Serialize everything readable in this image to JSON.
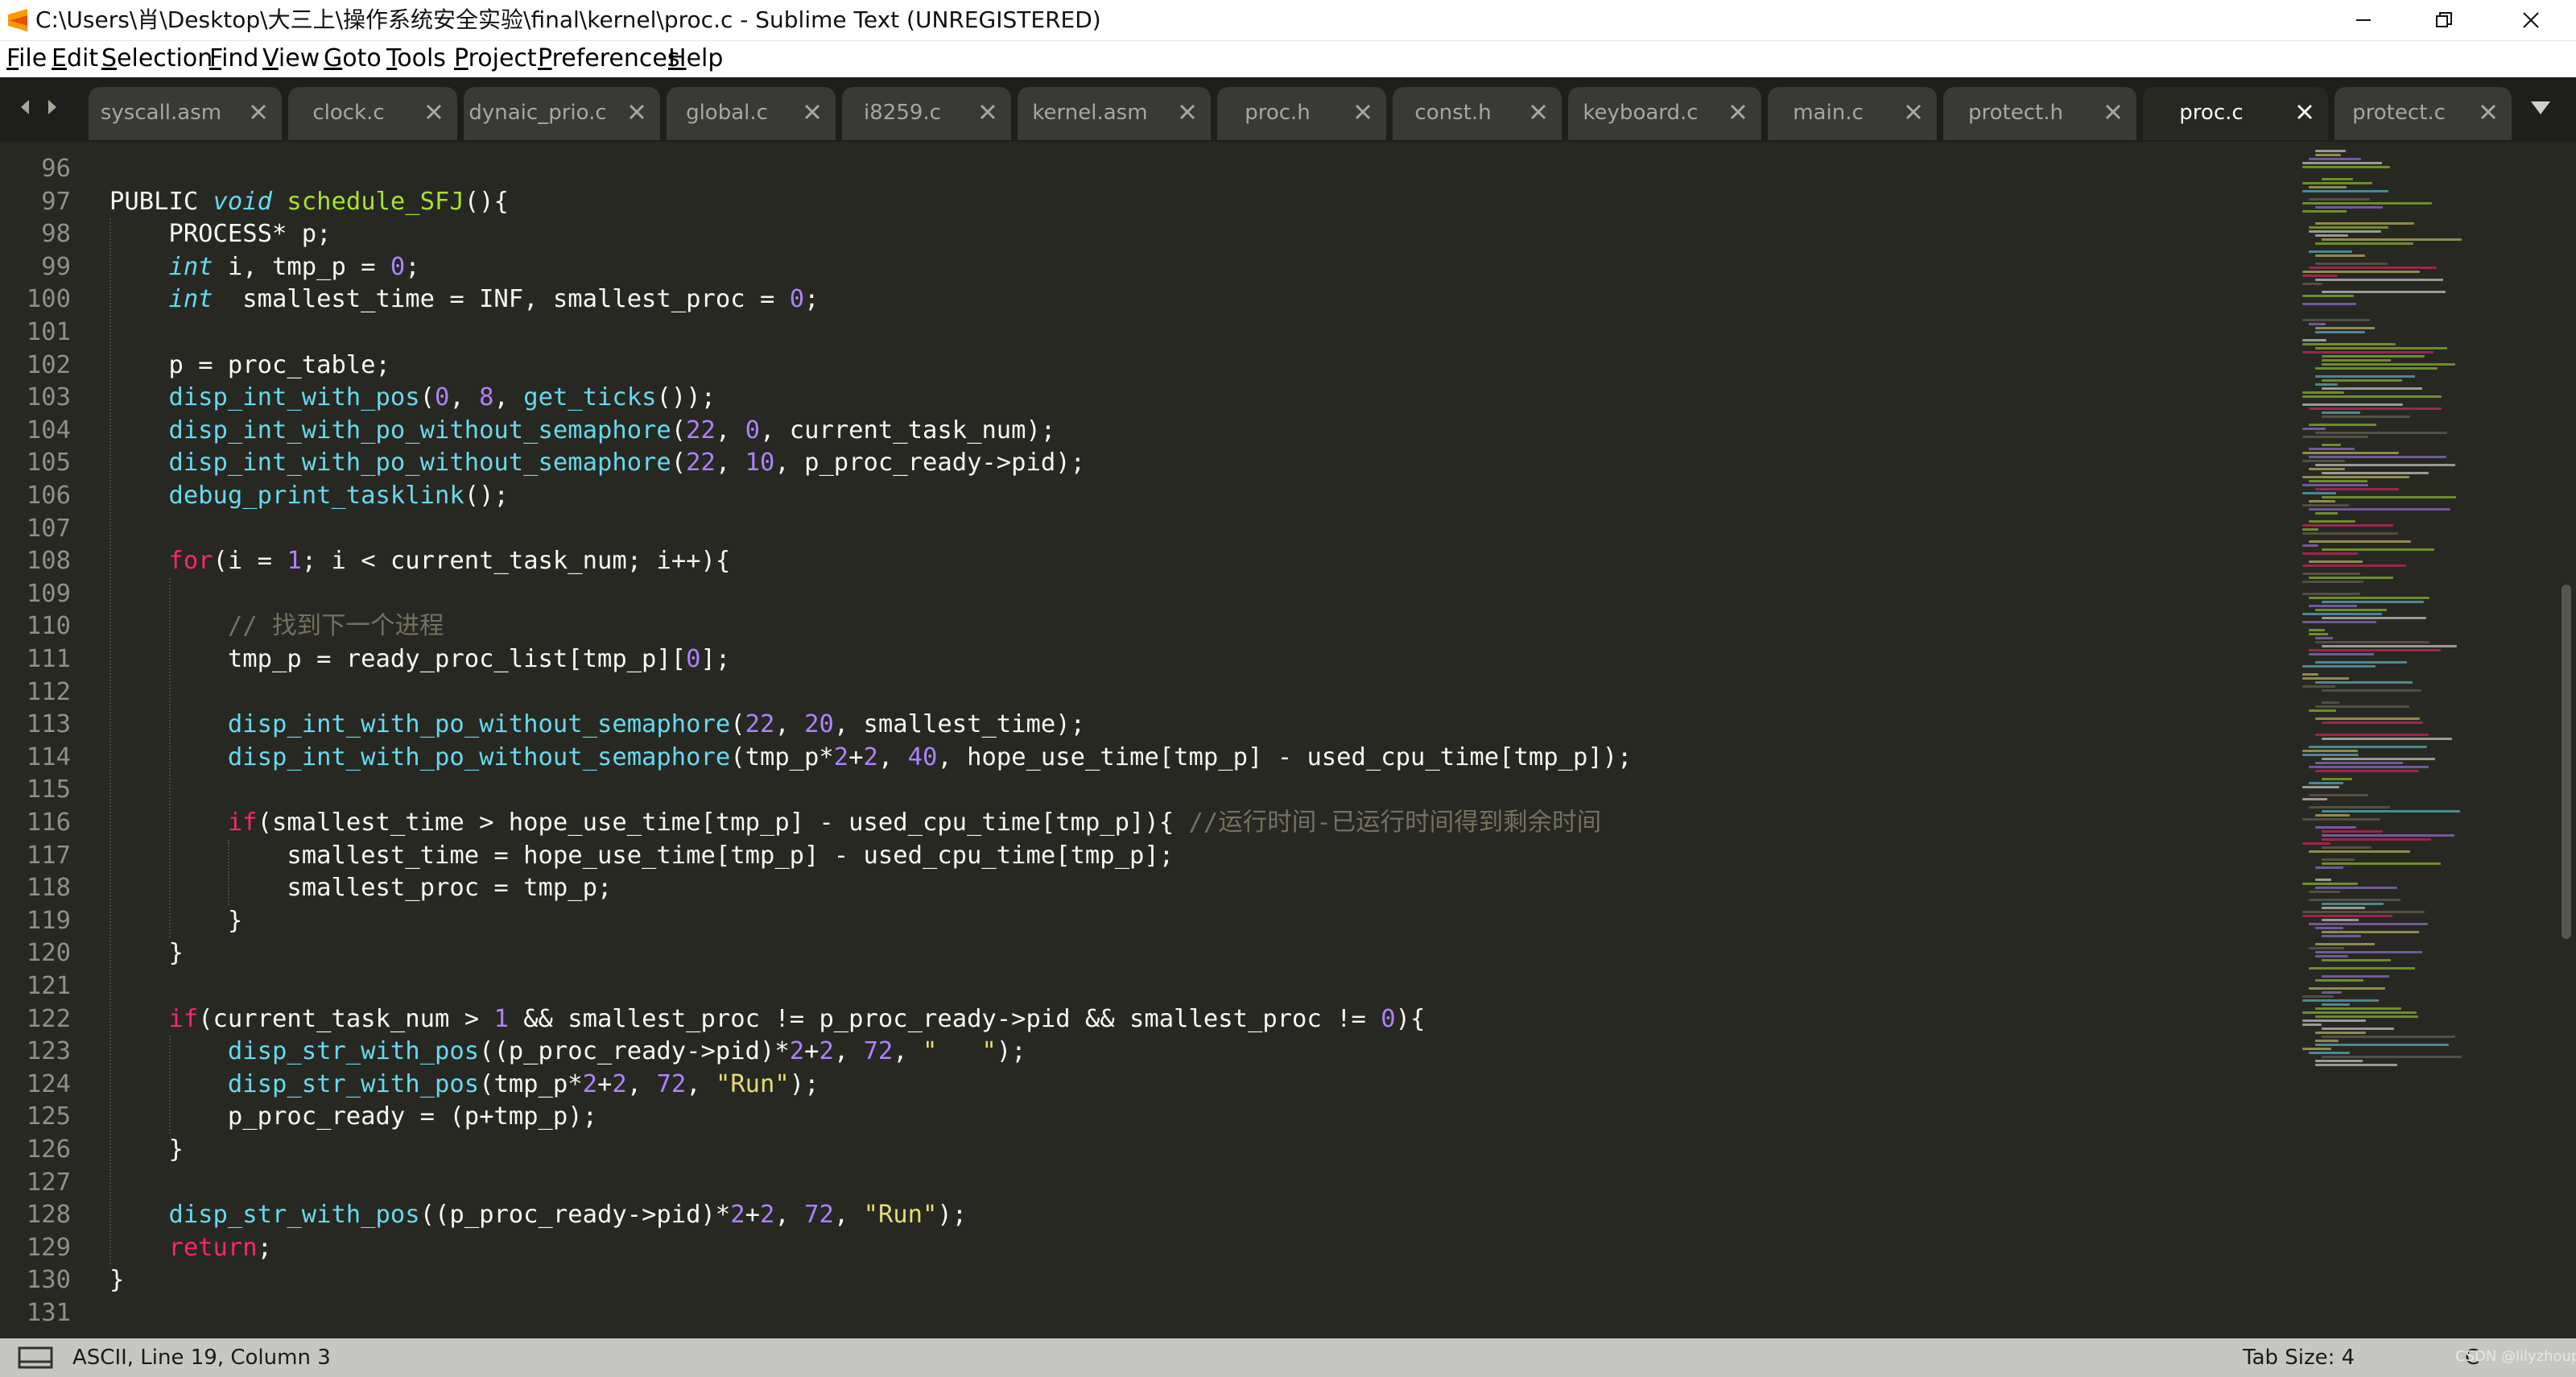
{
  "window": {
    "title": "C:\\Users\\肖\\Desktop\\大三上\\操作系统安全实验\\final\\kernel\\proc.c - Sublime Text (UNREGISTERED)",
    "icon": "sublime-text-icon"
  },
  "menu": {
    "items": [
      {
        "mn": "F",
        "rest": "ile"
      },
      {
        "mn": "E",
        "rest": "dit"
      },
      {
        "mn": "S",
        "rest": "election"
      },
      {
        "mn": "F",
        "rest": "ind"
      },
      {
        "mn": "V",
        "rest": "iew"
      },
      {
        "mn": "G",
        "rest": "oto"
      },
      {
        "mn": "T",
        "rest": "ools"
      },
      {
        "mn": "P",
        "rest": "roject"
      },
      {
        "mn": "P",
        "rest": "references"
      },
      {
        "mn": "H",
        "rest": "elp"
      }
    ]
  },
  "tabs": [
    {
      "label": "syscall.asm",
      "active": false
    },
    {
      "label": "clock.c",
      "active": false
    },
    {
      "label": "dynaic_prio.c",
      "active": false
    },
    {
      "label": "global.c",
      "active": false
    },
    {
      "label": "i8259.c",
      "active": false
    },
    {
      "label": "kernel.asm",
      "active": false
    },
    {
      "label": "proc.h",
      "active": false
    },
    {
      "label": "const.h",
      "active": false
    },
    {
      "label": "keyboard.c",
      "active": false
    },
    {
      "label": "main.c",
      "active": false
    },
    {
      "label": "protect.h",
      "active": false
    },
    {
      "label": "proc.c",
      "active": true
    },
    {
      "label": "protect.c",
      "active": false
    }
  ],
  "editor": {
    "line_numbers": [
      "96",
      "97",
      "98",
      "99",
      "100",
      "101",
      "102",
      "103",
      "104",
      "105",
      "106",
      "107",
      "108",
      "109",
      "110",
      "111",
      "112",
      "113",
      "114",
      "115",
      "116",
      "117",
      "118",
      "119",
      "120",
      "121",
      "122",
      "123",
      "124",
      "125",
      "126",
      "127",
      "128",
      "129",
      "130",
      "131"
    ],
    "lines": [
      [],
      [
        [
          "pl",
          "PUBLIC "
        ],
        [
          "ty",
          "void"
        ],
        [
          "pl",
          " "
        ],
        [
          "fn",
          "schedule_SFJ"
        ],
        [
          "pl",
          "(){"
        ]
      ],
      [
        [
          "pl",
          "    PROCESS* p;"
        ]
      ],
      [
        [
          "pl",
          "    "
        ],
        [
          "ty",
          "int"
        ],
        [
          "pl",
          " i, tmp_p = "
        ],
        [
          "nu",
          "0"
        ],
        [
          "pl",
          ";"
        ]
      ],
      [
        [
          "pl",
          "    "
        ],
        [
          "ty",
          "int"
        ],
        [
          "pl",
          "  smallest_time = INF, smallest_proc = "
        ],
        [
          "nu",
          "0"
        ],
        [
          "pl",
          ";"
        ]
      ],
      [],
      [
        [
          "pl",
          "    p = proc_table;"
        ]
      ],
      [
        [
          "pl",
          "    "
        ],
        [
          "ca",
          "disp_int_with_pos"
        ],
        [
          "pl",
          "("
        ],
        [
          "nu",
          "0"
        ],
        [
          "pl",
          ", "
        ],
        [
          "nu",
          "8"
        ],
        [
          "pl",
          ", "
        ],
        [
          "ca",
          "get_ticks"
        ],
        [
          "pl",
          "());"
        ]
      ],
      [
        [
          "pl",
          "    "
        ],
        [
          "ca",
          "disp_int_with_po_without_semaphore"
        ],
        [
          "pl",
          "("
        ],
        [
          "nu",
          "22"
        ],
        [
          "pl",
          ", "
        ],
        [
          "nu",
          "0"
        ],
        [
          "pl",
          ", current_task_num);"
        ]
      ],
      [
        [
          "pl",
          "    "
        ],
        [
          "ca",
          "disp_int_with_po_without_semaphore"
        ],
        [
          "pl",
          "("
        ],
        [
          "nu",
          "22"
        ],
        [
          "pl",
          ", "
        ],
        [
          "nu",
          "10"
        ],
        [
          "pl",
          ", p_proc_ready->pid);"
        ]
      ],
      [
        [
          "pl",
          "    "
        ],
        [
          "ca",
          "debug_print_tasklink"
        ],
        [
          "pl",
          "();"
        ]
      ],
      [],
      [
        [
          "pl",
          "    "
        ],
        [
          "kw",
          "for"
        ],
        [
          "pl",
          "(i = "
        ],
        [
          "nu",
          "1"
        ],
        [
          "pl",
          "; i < current_task_num; i++){"
        ]
      ],
      [],
      [
        [
          "pl",
          "        "
        ],
        [
          "cm",
          "// 找到下一个进程"
        ]
      ],
      [
        [
          "pl",
          "        tmp_p = ready_proc_list[tmp_p]["
        ],
        [
          "nu",
          "0"
        ],
        [
          "pl",
          "];"
        ]
      ],
      [],
      [
        [
          "pl",
          "        "
        ],
        [
          "ca",
          "disp_int_with_po_without_semaphore"
        ],
        [
          "pl",
          "("
        ],
        [
          "nu",
          "22"
        ],
        [
          "pl",
          ", "
        ],
        [
          "nu",
          "20"
        ],
        [
          "pl",
          ", smallest_time);"
        ]
      ],
      [
        [
          "pl",
          "        "
        ],
        [
          "ca",
          "disp_int_with_po_without_semaphore"
        ],
        [
          "pl",
          "(tmp_p*"
        ],
        [
          "nu",
          "2"
        ],
        [
          "pl",
          "+"
        ],
        [
          "nu",
          "2"
        ],
        [
          "pl",
          ", "
        ],
        [
          "nu",
          "40"
        ],
        [
          "pl",
          ", hope_use_time[tmp_p] - used_cpu_time[tmp_p]);"
        ]
      ],
      [],
      [
        [
          "pl",
          "        "
        ],
        [
          "kw",
          "if"
        ],
        [
          "pl",
          "(smallest_time > hope_use_time[tmp_p] - used_cpu_time[tmp_p]){ "
        ],
        [
          "cm",
          "//运行时间-已运行时间得到剩余时间"
        ]
      ],
      [
        [
          "pl",
          "            smallest_time = hope_use_time[tmp_p] - used_cpu_time[tmp_p];"
        ]
      ],
      [
        [
          "pl",
          "            smallest_proc = tmp_p;"
        ]
      ],
      [
        [
          "pl",
          "        }"
        ]
      ],
      [
        [
          "pl",
          "    }"
        ]
      ],
      [],
      [
        [
          "pl",
          "    "
        ],
        [
          "kw",
          "if"
        ],
        [
          "pl",
          "(current_task_num > "
        ],
        [
          "nu",
          "1"
        ],
        [
          "pl",
          " && smallest_proc != p_proc_ready->pid && smallest_proc != "
        ],
        [
          "nu",
          "0"
        ],
        [
          "pl",
          "){"
        ]
      ],
      [
        [
          "pl",
          "        "
        ],
        [
          "ca",
          "disp_str_with_pos"
        ],
        [
          "pl",
          "((p_proc_ready->pid)*"
        ],
        [
          "nu",
          "2"
        ],
        [
          "pl",
          "+"
        ],
        [
          "nu",
          "2"
        ],
        [
          "pl",
          ", "
        ],
        [
          "nu",
          "72"
        ],
        [
          "pl",
          ", "
        ],
        [
          "st",
          "\"   \""
        ],
        [
          "pl",
          ");"
        ]
      ],
      [
        [
          "pl",
          "        "
        ],
        [
          "ca",
          "disp_str_with_pos"
        ],
        [
          "pl",
          "(tmp_p*"
        ],
        [
          "nu",
          "2"
        ],
        [
          "pl",
          "+"
        ],
        [
          "nu",
          "2"
        ],
        [
          "pl",
          ", "
        ],
        [
          "nu",
          "72"
        ],
        [
          "pl",
          ", "
        ],
        [
          "st",
          "\"Run\""
        ],
        [
          "pl",
          ");"
        ]
      ],
      [
        [
          "pl",
          "        p_proc_ready = (p+tmp_p);"
        ]
      ],
      [
        [
          "pl",
          "    }"
        ]
      ],
      [],
      [
        [
          "pl",
          "    "
        ],
        [
          "ca",
          "disp_str_with_pos"
        ],
        [
          "pl",
          "((p_proc_ready->pid)*"
        ],
        [
          "nu",
          "2"
        ],
        [
          "pl",
          "+"
        ],
        [
          "nu",
          "2"
        ],
        [
          "pl",
          ", "
        ],
        [
          "nu",
          "72"
        ],
        [
          "pl",
          ", "
        ],
        [
          "st",
          "\"Run\""
        ],
        [
          "pl",
          ");"
        ]
      ],
      [
        [
          "pl",
          "    "
        ],
        [
          "kw",
          "return"
        ],
        [
          "pl",
          ";"
        ]
      ],
      [
        [
          "pl",
          "}"
        ]
      ],
      []
    ]
  },
  "statusbar": {
    "position": "ASCII, Line 19, Column 3",
    "tab_size": "Tab Size: 4",
    "syntax": "C",
    "watermark": "CSDN @lilyzhoupip"
  },
  "colors": {
    "background": "#272822",
    "keyword": "#f92672",
    "storage_type": "#66d9ef",
    "function_def": "#a6e22e",
    "number": "#ae81ff",
    "string": "#e6db74",
    "comment": "#75715e"
  }
}
